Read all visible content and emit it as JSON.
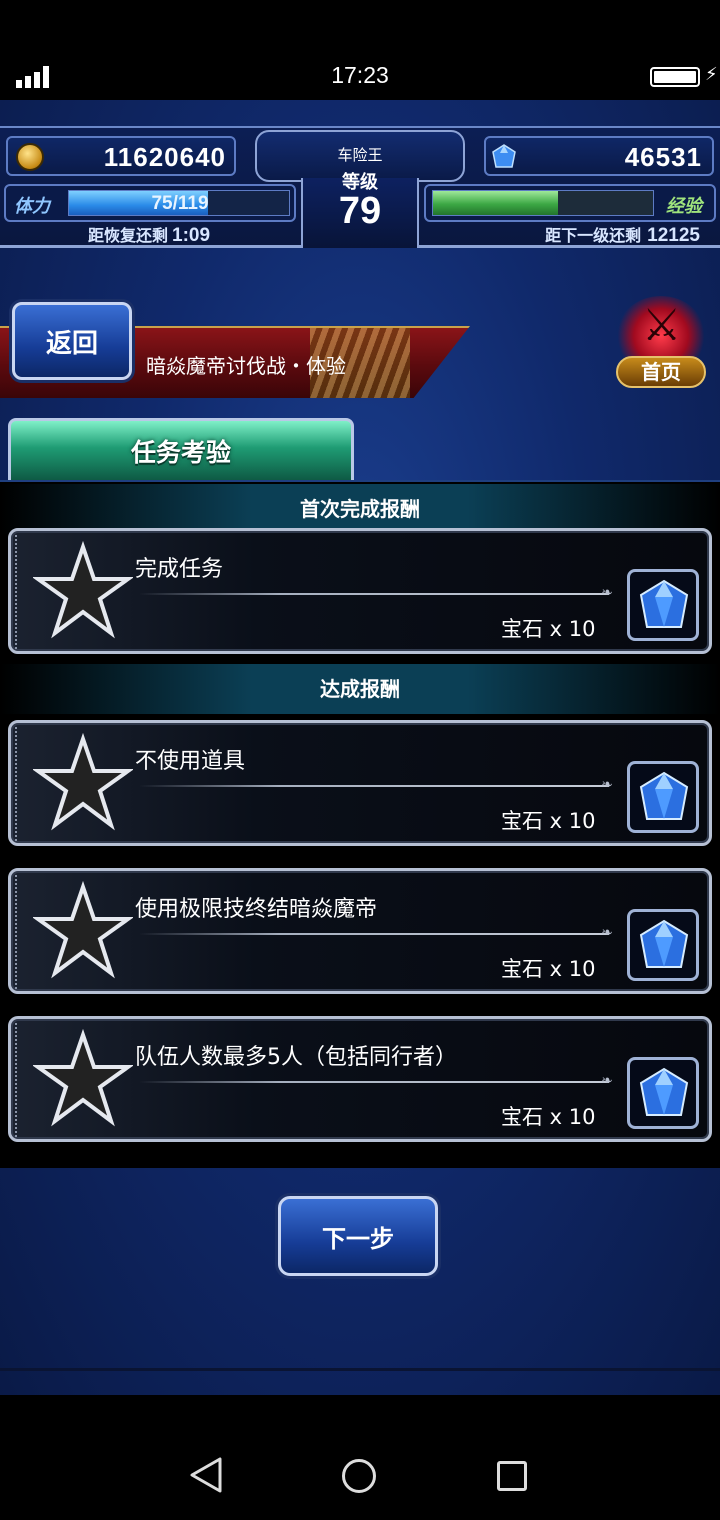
{
  "status_bar": {
    "time": "17:23",
    "battery_level": 1.0
  },
  "hud": {
    "gil": "11620640",
    "gems": "46531",
    "player_name": "车险王",
    "level_label": "等级",
    "level": "79",
    "stamina_label": "体力",
    "stamina_text": "75/119",
    "stamina_current": 75,
    "stamina_max": 119,
    "recover_label": "距恢复还剩",
    "recover_time": "1:09",
    "exp_label": "经验",
    "exp_fraction": 0.57,
    "next_label": "距下一级还剩",
    "next_value": "12125"
  },
  "header": {
    "back_label": "返回",
    "mission_title": "暗焱魔帝讨伐战・体验",
    "home_label": "首页"
  },
  "tab": {
    "label": "任务考验"
  },
  "sections": [
    {
      "label": "首次完成报酬"
    },
    {
      "label": "达成报酬"
    }
  ],
  "missions": [
    {
      "name": "完成任务",
      "reward": "宝石 x 10"
    },
    {
      "name": "不使用道具",
      "reward": "宝石 x 10"
    },
    {
      "name": "使用极限技终结暗焱魔帝",
      "reward": "宝石 x 10"
    },
    {
      "name": "队伍人数最多5人（包括同行者）",
      "reward": "宝石 x 10"
    }
  ],
  "next_button": {
    "label": "下一步"
  },
  "colors": {
    "accent_blue": "#163c96",
    "panel_bg": "#000000",
    "section_teal": "#0b3f55",
    "ribbon_red": "#8a1418"
  },
  "icons": [
    "signal-icon",
    "battery-icon",
    "coin-icon",
    "gem-icon",
    "star-icon",
    "crossed-swords-icon",
    "nav-back-icon",
    "nav-home-icon",
    "nav-recent-icon"
  ]
}
